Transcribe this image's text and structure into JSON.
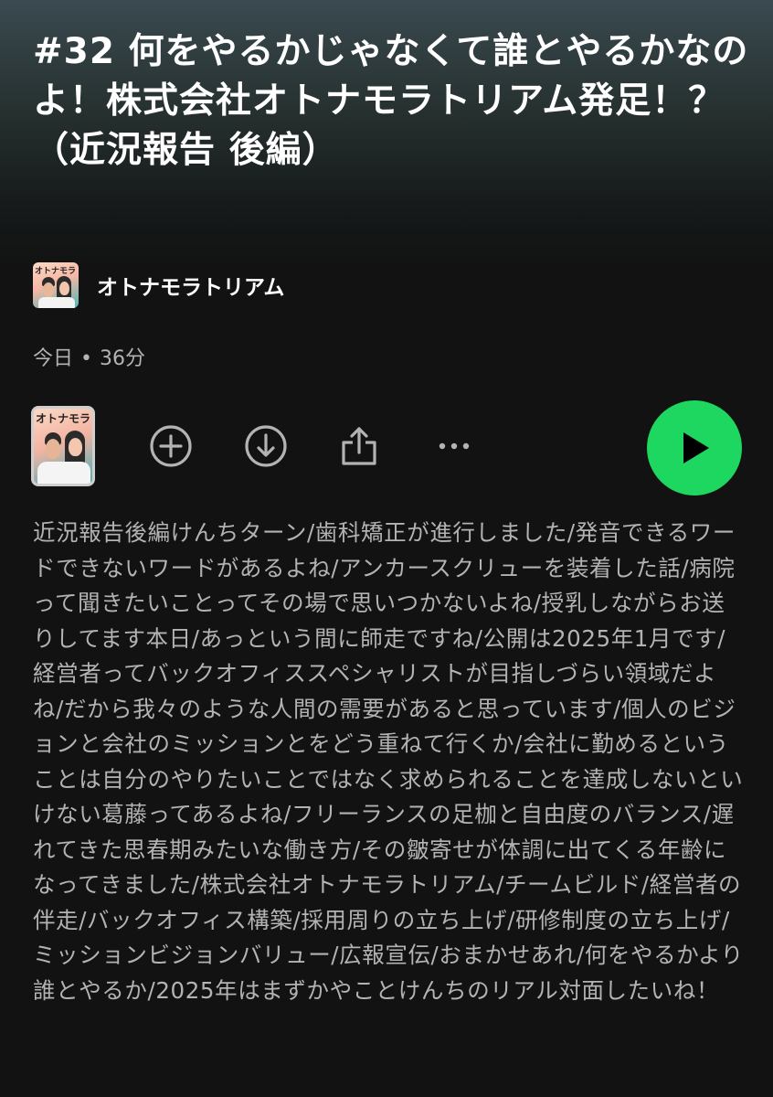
{
  "episode": {
    "title": "#32 何をやるかじゃなくて誰とやるかなのよ！株式会社オトナモラトリアム発足！？（近況報告 後編）",
    "date": "今日",
    "separator": "•",
    "duration": "36分",
    "description": "近況報告後編けんちターン/歯科矯正が進行しました/発音できるワードできないワードがあるよね/アンカースクリューを装着した話/病院って聞きたいことってその場で思いつかないよね/授乳しながらお送りしてます本日/あっという間に師走ですね/公開は2025年1月です/ 経営者ってバックオフィススペシャリストが目指しづらい領域だよね/だから我々のような人間の需要があると思っています/個人のビジョンと会社のミッションとをどう重ねて行くか/会社に勤めるということは自分のやりたいことではなく求められることを達成しないといけない葛藤ってあるよね/フリーランスの足枷と自由度のバランス/遅れてきた思春期みたいな働き方/その皺寄せが体調に出てくる年齢になってきました/株式会社オトナモラトリアム/チームビルド/経営者の伴走/バックオフィス構築/採用周りの立ち上げ/研修制度の立ち上げ/ミッションビジョンバリュー/広報宣伝/おまかせあれ/何をやるかより誰とやるか/2025年はまずかやことけんちのリアル対面したいね！"
  },
  "show": {
    "name": "オトナモラトリアム",
    "artwork_text": "オトナモラトリアム"
  },
  "controls": {
    "add_icon": "plus-circle-icon",
    "download_icon": "download-circle-icon",
    "share_icon": "share-icon",
    "more_icon": "more-horizontal-icon",
    "play_icon": "play-icon"
  },
  "colors": {
    "accent": "#1ed760",
    "background": "#121212",
    "secondary_text": "#b3b3b3"
  }
}
